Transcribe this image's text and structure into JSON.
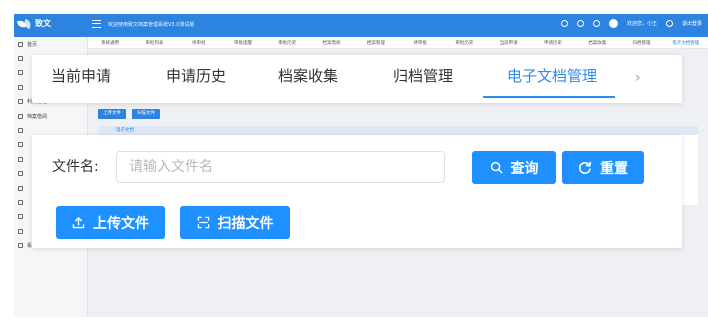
{
  "app": {
    "logo_text": "致文",
    "system_title": "欢迎使用致文档案管理系统V3.0测试版",
    "user_greeting": "欢迎您，小王",
    "logout_label": "退出登录"
  },
  "sidebar": {
    "items": [
      {
        "label": "首页",
        "icon": "home-icon"
      },
      {
        "label": "",
        "icon": "doc-icon"
      },
      {
        "label": "",
        "icon": "doc-icon"
      },
      {
        "label": "",
        "icon": "doc-icon"
      },
      {
        "label": "利用管理",
        "icon": "user-icon",
        "arrow": "⌄"
      },
      {
        "label": "档案借阅",
        "icon": "doc-icon"
      },
      {
        "label": "",
        "icon": "doc-icon"
      },
      {
        "label": "",
        "icon": "doc-icon"
      },
      {
        "label": "",
        "icon": "doc-icon"
      },
      {
        "label": "",
        "icon": "doc-icon"
      },
      {
        "label": "",
        "icon": "doc-icon"
      },
      {
        "label": "",
        "icon": "doc-icon"
      },
      {
        "label": "",
        "icon": "doc-icon"
      },
      {
        "label": "",
        "icon": "doc-icon"
      },
      {
        "label": "系统管理",
        "icon": "gear-icon",
        "arrow": "⌄"
      }
    ]
  },
  "tagbar": {
    "items": [
      "系统通用",
      "审批列表",
      "待审批",
      "审批提醒",
      "审批历史",
      "档案借阅",
      "档案管理",
      "待审批",
      "审批历史",
      "当前申请",
      "申请历史",
      "档案收集",
      "归档管理",
      "电子文档管理"
    ],
    "active_index": 13
  },
  "background": {
    "upload_label": "上传文件",
    "scan_label": "扫描文件",
    "subtab_label": "电子文档"
  },
  "tabs": {
    "items": [
      {
        "label": "当前申请",
        "active": false
      },
      {
        "label": "申请历史",
        "active": false
      },
      {
        "label": "档案收集",
        "active": false
      },
      {
        "label": "归档管理",
        "active": false
      },
      {
        "label": "电子文档管理",
        "active": true
      }
    ],
    "next_glyph": "›"
  },
  "search": {
    "file_name_label": "文件名:",
    "file_name_placeholder": "请输入文件名",
    "file_name_value": "",
    "query_label": "查询",
    "reset_label": "重置"
  },
  "actions": {
    "upload_label": "上传文件",
    "scan_label": "扫描文件"
  },
  "colors": {
    "primary": "#1e90ff",
    "header": "#2d83e0",
    "tab_active": "#2d8cf0"
  }
}
